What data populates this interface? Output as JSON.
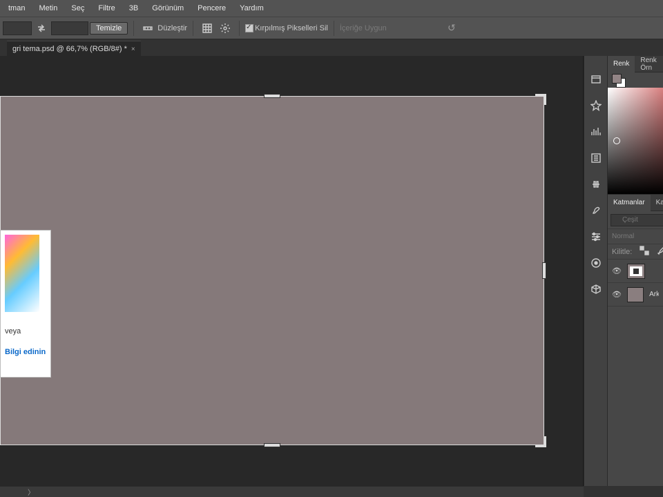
{
  "menu": [
    "tman",
    "Metin",
    "Seç",
    "Filtre",
    "3B",
    "Görünüm",
    "Pencere",
    "Yardım"
  ],
  "options": {
    "temizle": "Temizle",
    "duzlestir": "Düzleştir",
    "kirpilmis_check": "Kırpılmış Pikselleri Sil",
    "icerige_uygun": "İçeriğe Uygun"
  },
  "doc_tab": "gri tema.psd @ 66,7% (RGB/8#) *",
  "popup": {
    "veya": "veya",
    "link": "Bilgi edinin"
  },
  "panels": {
    "renk_tab": "Renk",
    "renk_orn_tab": "Renk Örn",
    "katmanlar_tab": "Katmanlar",
    "ka_tab": "Ka",
    "filter_placeholder": "Çeşit",
    "blend": "Normal",
    "kilitle": "Kilitle:",
    "layer2": "Ark"
  },
  "status_caret": "〉"
}
